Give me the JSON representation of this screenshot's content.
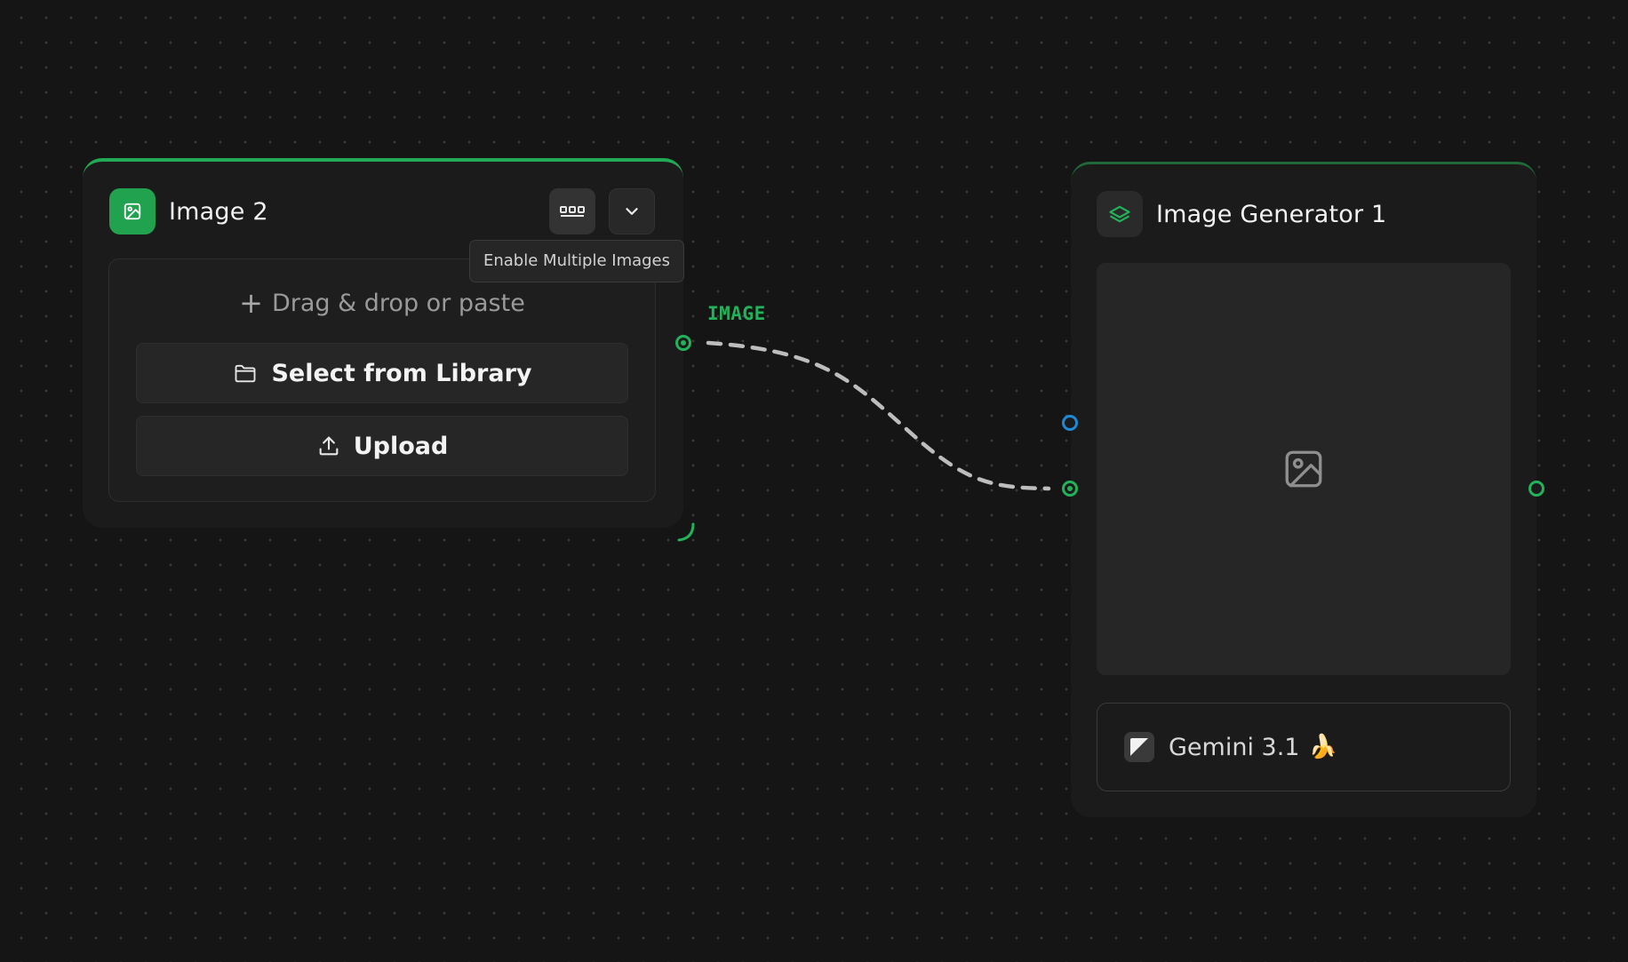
{
  "image_node": {
    "title": "Image 2",
    "drop_hint": "Drag & drop or paste",
    "library_button": "Select from Library",
    "upload_button": "Upload",
    "tooltip": "Enable Multiple Images",
    "output_port_label": "IMAGE",
    "accent_color": "#22a955"
  },
  "generator_node": {
    "title": "Image Generator 1",
    "model_label": "Gemini 3.1",
    "model_emoji": "🍌"
  },
  "colors": {
    "canvas_background": "#151515",
    "node_background": "#1b1b1b",
    "port_green": "#22b35a",
    "port_blue": "#1e8ad6",
    "edge": "#bdbdbd"
  },
  "icons": {
    "image_node_icon": "image-icon",
    "multi_images_button": "grid-dots-icon",
    "collapse_button": "chevron-down-icon",
    "library_icon": "folder-icon",
    "upload_icon": "upload-icon",
    "generator_icon": "layers-icon",
    "preview_placeholder": "image-placeholder-icon",
    "model_icon": "gemini-logo-icon"
  }
}
